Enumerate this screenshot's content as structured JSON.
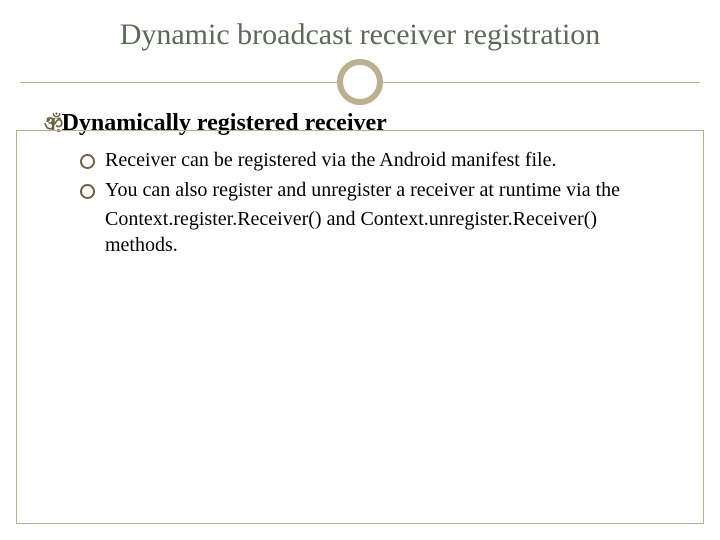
{
  "title": "Dynamic broadcast receiver registration",
  "heading": "Dynamically registered receiver",
  "bullets": {
    "b1": "Receiver can be registered via the Android manifest file.",
    "b2_l1": " You can also register and unregister a receiver at runtime via the",
    "b2_l2": "Context.register.Receiver() and Context.unregister.Receiver() methods."
  }
}
